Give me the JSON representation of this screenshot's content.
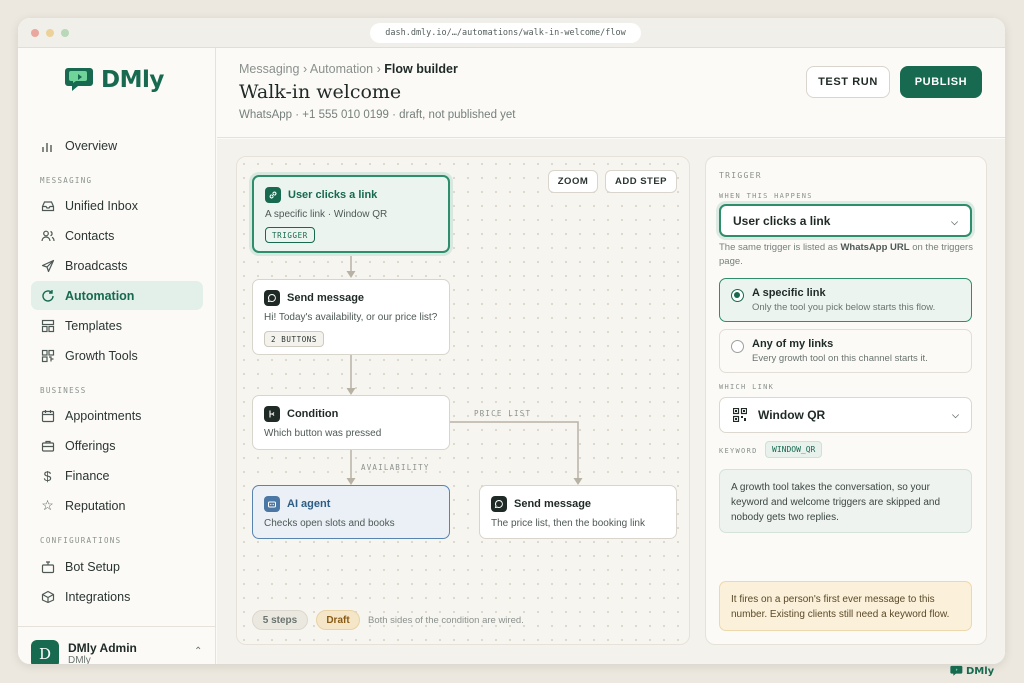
{
  "browser": {
    "url": "dash.dmly.io/…/automations/walk-in-welcome/flow"
  },
  "brand": {
    "name": "DMly",
    "accent": "#17694f"
  },
  "sidebar": {
    "overview": "Overview",
    "sections": {
      "messaging": "MESSAGING",
      "business": "BUSINESS",
      "configurations": "CONFIGURATIONS"
    },
    "items": {
      "unified_inbox": "Unified Inbox",
      "contacts": "Contacts",
      "broadcasts": "Broadcasts",
      "automation": "Automation",
      "templates": "Templates",
      "growth_tools": "Growth Tools",
      "appointments": "Appointments",
      "offerings": "Offerings",
      "finance": "Finance",
      "reputation": "Reputation",
      "bot_setup": "Bot Setup",
      "integrations": "Integrations"
    },
    "user": {
      "initial": "D",
      "name": "DMly Admin",
      "org": "DMly"
    }
  },
  "header": {
    "breadcrumb": [
      "Messaging",
      "Automation",
      "Flow builder"
    ],
    "title": "Walk-in welcome",
    "subtitle": "WhatsApp · +1 555 010 0199 · draft, not published yet",
    "test_run": "TEST RUN",
    "publish": "PUBLISH"
  },
  "canvas": {
    "zoom": "ZOOM",
    "add_step": "ADD STEP",
    "nodes": {
      "trigger": {
        "title": "User clicks a link",
        "desc": "A specific link · Window QR",
        "tag": "TRIGGER"
      },
      "send1": {
        "title": "Send message",
        "desc": "Hi! Today's availability, or our price list?",
        "tag": "2 BUTTONS"
      },
      "condition": {
        "title": "Condition",
        "desc": "Which button was pressed"
      },
      "ai_agent": {
        "title": "AI agent",
        "desc": "Checks open slots and books"
      },
      "send2": {
        "title": "Send message",
        "desc": "The price list, then the booking link"
      }
    },
    "edges": {
      "price_list": "PRICE LIST",
      "availability": "AVAILABILITY"
    },
    "footer": {
      "steps": "5 steps",
      "status": "Draft",
      "note": "Both sides of the condition are wired."
    }
  },
  "panel": {
    "heading": "TRIGGER",
    "when_label": "WHEN THIS HAPPENS",
    "when_value": "User clicks a link",
    "helper_pre": "The same trigger is listed as ",
    "helper_bold": "WhatsApp URL",
    "helper_post": " on the triggers page.",
    "options": [
      {
        "title": "A specific link",
        "desc": "Only the tool you pick below starts this flow.",
        "selected": true
      },
      {
        "title": "Any of my links",
        "desc": "Every growth tool on this channel starts it.",
        "selected": false
      }
    ],
    "which_label": "WHICH LINK",
    "which_value": "Window QR",
    "keyword_label": "KEYWORD",
    "keyword_value": "WINDOW_QR",
    "info": "A growth tool takes the conversation, so your keyword and welcome triggers are skipped and nobody gets two replies.",
    "warning": "It fires on a person's first ever message to this number. Existing clients still need a keyword flow."
  }
}
